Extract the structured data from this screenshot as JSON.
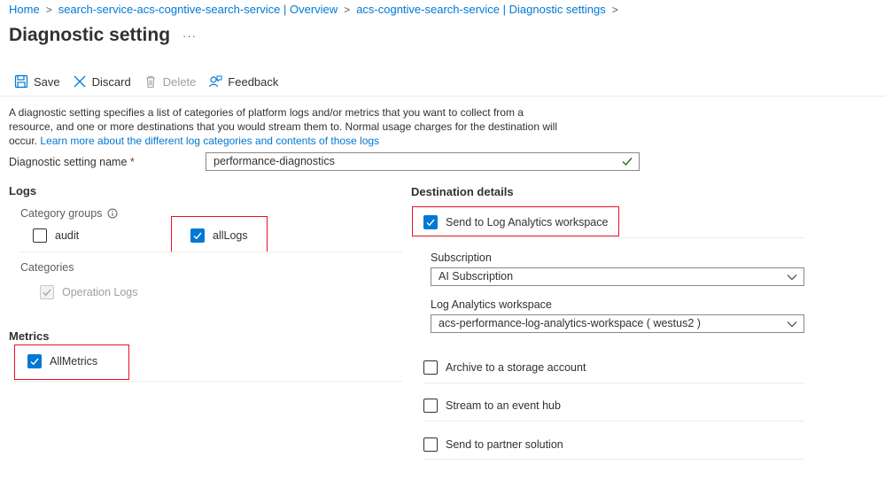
{
  "breadcrumb": {
    "items": [
      "Home",
      "search-service-acs-cogntive-search-service | Overview",
      "acs-cogntive-search-service | Diagnostic settings"
    ]
  },
  "page": {
    "title": "Diagnostic setting",
    "more": "···"
  },
  "toolbar": {
    "save": "Save",
    "discard": "Discard",
    "delete": "Delete",
    "feedback": "Feedback"
  },
  "description": {
    "text": "A diagnostic setting specifies a list of categories of platform logs and/or metrics that you want to collect from a resource, and one or more destinations that you would stream them to. Normal usage charges for the destination will occur.",
    "link": "Learn more about the different log categories and contents of those logs"
  },
  "name_field": {
    "label": "Diagnostic setting name",
    "required": "*",
    "value": "performance-diagnostics"
  },
  "logs": {
    "heading": "Logs",
    "category_groups_label": "Category groups",
    "audit": "audit",
    "alllogs": "allLogs",
    "categories_label": "Categories",
    "operation_logs": "Operation Logs"
  },
  "metrics": {
    "heading": "Metrics",
    "allmetrics": "AllMetrics"
  },
  "destination": {
    "heading": "Destination details",
    "log_analytics": "Send to Log Analytics workspace",
    "subscription_label": "Subscription",
    "subscription_value": "AI Subscription",
    "workspace_label": "Log Analytics workspace",
    "workspace_value": "acs-performance-log-analytics-workspace ( westus2 )",
    "storage": "Archive to a storage account",
    "event_hub": "Stream to an event hub",
    "partner": "Send to partner solution"
  },
  "colors": {
    "accent": "#0078d4",
    "highlight": "#e81123",
    "valid": "#107c10"
  }
}
